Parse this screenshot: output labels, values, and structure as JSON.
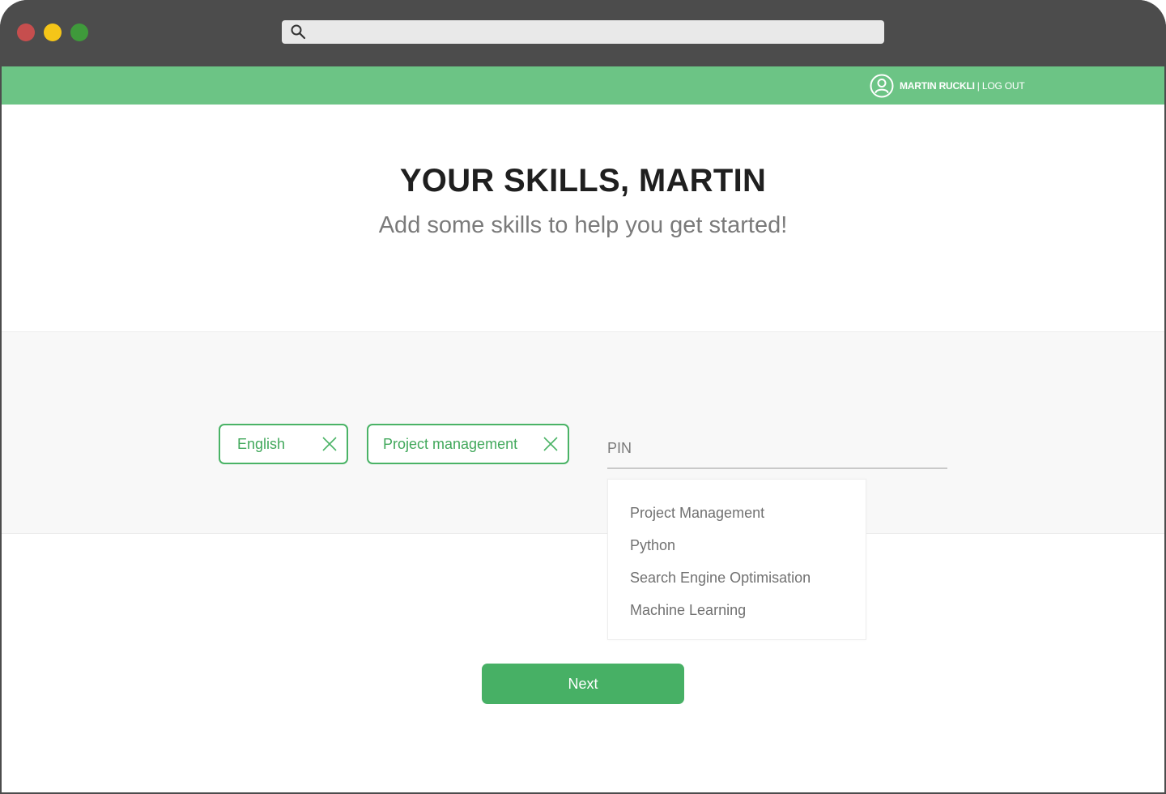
{
  "colors": {
    "window_chrome": "#4c4c4c",
    "close_dot": "#c64e4e",
    "minimize_dot": "#f5c518",
    "maximize_dot": "#3f9a3b",
    "appbar": "#6cc485",
    "accent": "#4ab366",
    "next_button": "#47b065"
  },
  "browser": {
    "address_icon": "search-icon",
    "address_value": ""
  },
  "header": {
    "user_icon": "user-circle-icon",
    "user_name": "MARTIN RUCKLI",
    "separator": "|",
    "logout_label": "LOG OUT"
  },
  "hero": {
    "title": "YOUR SKILLS, MARTIN",
    "subtitle": "Add some skills to help you get started!"
  },
  "skills": {
    "selected": [
      {
        "label": "English",
        "close_icon": "close-icon"
      },
      {
        "label": "Project management",
        "close_icon": "close-icon"
      }
    ],
    "input_value": "PIN",
    "suggestions": [
      "Project Management",
      "Python",
      "Search Engine Optimisation",
      "Machine Learning"
    ]
  },
  "actions": {
    "next_label": "Next"
  }
}
